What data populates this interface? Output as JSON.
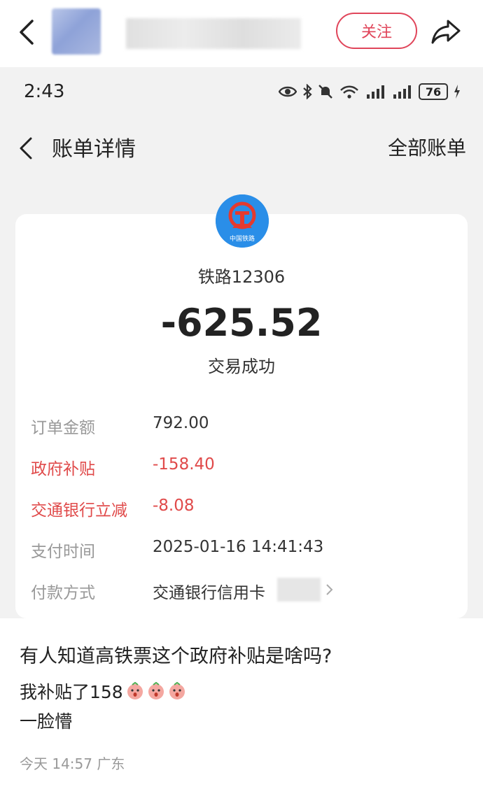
{
  "topbar": {
    "follow_label": "关注"
  },
  "statusbar": {
    "time": "2:43",
    "battery": "76"
  },
  "bill_header": {
    "title": "账单详情",
    "all_bills": "全部账单"
  },
  "bill": {
    "logo_text": "中国铁路",
    "merchant": "铁路12306",
    "amount": "-625.52",
    "status": "交易成功",
    "rows": [
      {
        "label": "订单金额",
        "value": "792.00"
      },
      {
        "label": "政府补贴",
        "value": "-158.40"
      },
      {
        "label": "交通银行立减",
        "value": "-8.08"
      },
      {
        "label": "支付时间",
        "value": "2025-01-16 14:41:43"
      },
      {
        "label": "付款方式",
        "value": "交通银行信用卡"
      }
    ]
  },
  "post": {
    "question": "有人知道高铁票这个政府补贴是啥吗?",
    "line1": "我补贴了158",
    "line2": "一脸懵",
    "meta": "今天 14:57 广东"
  },
  "colors": {
    "accent_red": "#e04a4a",
    "follow_red": "#e0455a",
    "logo_blue": "#2a8ee8"
  }
}
